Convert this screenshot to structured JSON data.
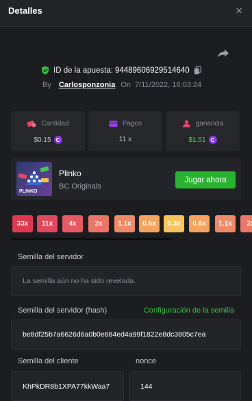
{
  "header": {
    "title": "Detalles",
    "close_glyph": "×"
  },
  "bet": {
    "id_label": "ID de la apuesta:",
    "id_value": "94489606929514640",
    "by_label": "By",
    "username": "Carlosponzonia",
    "on_label": "On",
    "datetime": "7/11/2022, 16:03:24"
  },
  "stats": [
    {
      "label": "Cantidad",
      "value": "$0.15",
      "icon": "money-icon",
      "icon_color": "#e8456b"
    },
    {
      "label": "Pagos",
      "value": "11 x",
      "icon": "wallet-icon",
      "icon_color": "#9b3fe0"
    },
    {
      "label": "ganancia",
      "value": "$1.51",
      "icon": "profit-icon",
      "icon_color": "#e8456b"
    }
  ],
  "coin_symbol": "C",
  "game": {
    "name": "Plinko",
    "provider": "BC Originals",
    "thumb_label": "PLINKO",
    "play_label": "Jugar ahora"
  },
  "multipliers": [
    {
      "label": "33x",
      "color": "#e0384f"
    },
    {
      "label": "11x",
      "color": "#e3485a"
    },
    {
      "label": "4x",
      "color": "#e85a60"
    },
    {
      "label": "2x",
      "color": "#ec7566"
    },
    {
      "label": "1.1x",
      "color": "#f08a66"
    },
    {
      "label": "0.6x",
      "color": "#f4a45f"
    },
    {
      "label": "0.3x",
      "color": "#f6c45a"
    },
    {
      "label": "0.6x",
      "color": "#f4a45f"
    },
    {
      "label": "1.1x",
      "color": "#f08a66"
    },
    {
      "label": "2x",
      "color": "#ec7566"
    }
  ],
  "seeds": {
    "server_seed_label": "Semilla del servidor",
    "server_seed_placeholder": "La semilla aún no ha sido revelada.",
    "server_hash_label": "Semilla del servidor (hash)",
    "seed_config_link": "Configuración de la semilla",
    "server_hash_value": "be8df25b7a6626d6a0b0e684ed4a99f1822e8dc3805c7ea",
    "client_seed_label": "Semilla del cliente",
    "client_seed_value": "KhPkDR8b1XPA77kkWaa7",
    "nonce_label": "nonce",
    "nonce_value": "144"
  }
}
